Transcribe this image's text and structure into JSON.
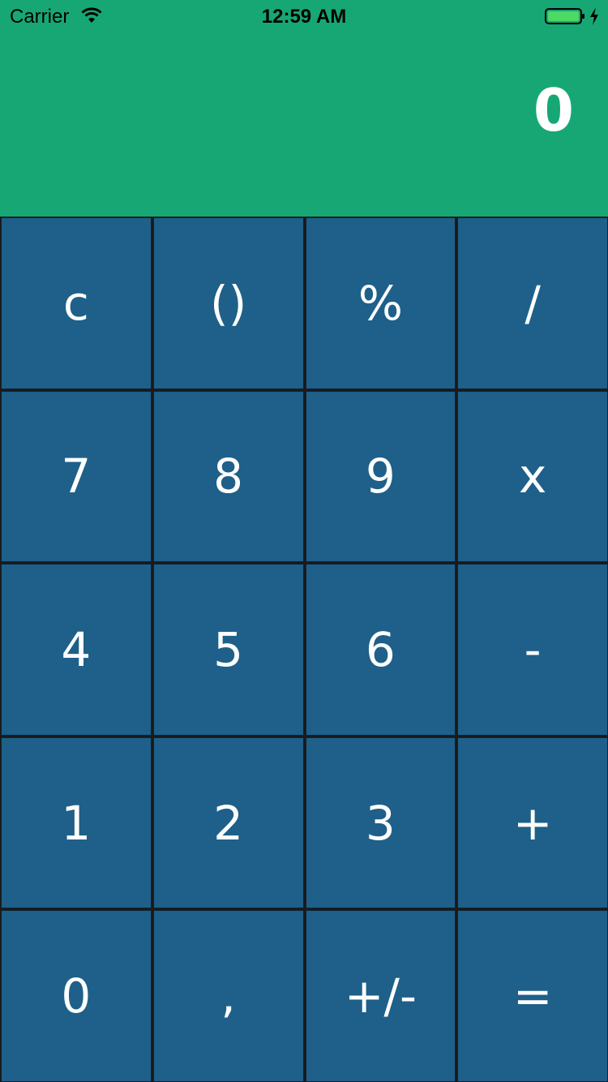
{
  "status_bar": {
    "carrier": "Carrier",
    "time": "12:59 AM",
    "battery_color": "#4cd964"
  },
  "display": {
    "value": "0",
    "background": "#17a775"
  },
  "keypad": {
    "key_color": "#1e6089",
    "keys": [
      {
        "label": "c"
      },
      {
        "label": "()"
      },
      {
        "label": "%"
      },
      {
        "label": "/"
      },
      {
        "label": "7"
      },
      {
        "label": "8"
      },
      {
        "label": "9"
      },
      {
        "label": "x"
      },
      {
        "label": "4"
      },
      {
        "label": "5"
      },
      {
        "label": "6"
      },
      {
        "label": "-"
      },
      {
        "label": "1"
      },
      {
        "label": "2"
      },
      {
        "label": "3"
      },
      {
        "label": "+"
      },
      {
        "label": "0"
      },
      {
        "label": ","
      },
      {
        "label": "+/-"
      },
      {
        "label": "="
      }
    ]
  }
}
